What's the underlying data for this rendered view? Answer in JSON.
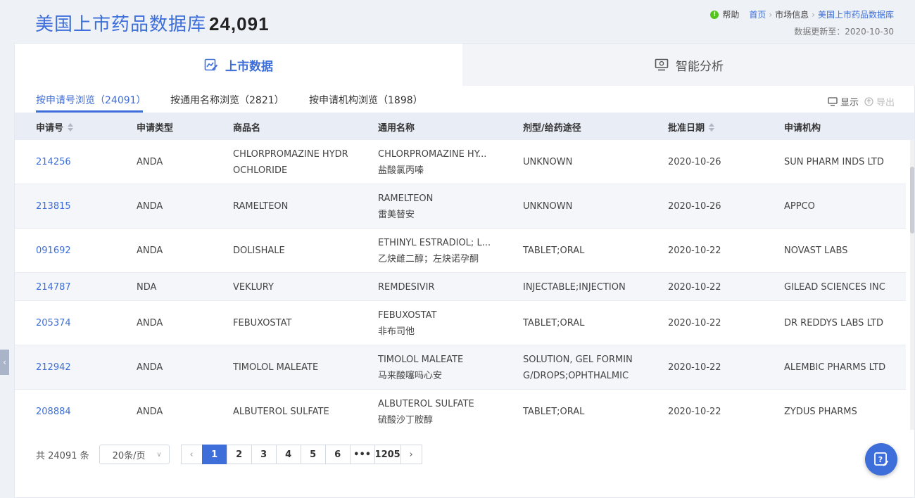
{
  "header": {
    "title": "美国上市药品数据库",
    "count": "24,091",
    "help_label": "帮助",
    "breadcrumb": [
      "首页",
      "市场信息",
      "美国上市药品数据库"
    ],
    "update_label": "数据更新至：",
    "update_date": "2020-10-30"
  },
  "tabs": [
    {
      "label": "上市数据",
      "active": true
    },
    {
      "label": "智能分析",
      "active": false
    }
  ],
  "subnav": [
    {
      "label": "按申请号浏览（24091）",
      "active": true
    },
    {
      "label": "按通用名称浏览（2821）",
      "active": false
    },
    {
      "label": "按申请机构浏览（1898）",
      "active": false
    }
  ],
  "toolbar": {
    "display_label": "显示",
    "export_label": "导出"
  },
  "columns": [
    "申请号",
    "申请类型",
    "商品名",
    "通用名称",
    "剂型/给药途径",
    "批准日期",
    "申请机构"
  ],
  "rows": [
    {
      "appl_no": "214256",
      "type": "ANDA",
      "trade_name": [
        "CHLORPROMAZINE HYDR",
        "OCHLORIDE"
      ],
      "generic_en": "CHLORPROMAZINE HY...",
      "generic_cn": "盐酸氯丙嗪",
      "dosage": [
        "UNKNOWN"
      ],
      "date": "2020-10-26",
      "applicant": "SUN PHARM INDS LTD"
    },
    {
      "appl_no": "213815",
      "type": "ANDA",
      "trade_name": [
        "RAMELTEON"
      ],
      "generic_en": "RAMELTEON",
      "generic_cn": "雷美替安",
      "dosage": [
        "UNKNOWN"
      ],
      "date": "2020-10-26",
      "applicant": "APPCO"
    },
    {
      "appl_no": "091692",
      "type": "ANDA",
      "trade_name": [
        "DOLISHALE"
      ],
      "generic_en": "ETHINYL ESTRADIOL; L...",
      "generic_cn": "乙炔雌二醇；左炔诺孕酮",
      "dosage": [
        "TABLET;ORAL"
      ],
      "date": "2020-10-22",
      "applicant": "NOVAST LABS"
    },
    {
      "appl_no": "214787",
      "type": "NDA",
      "trade_name": [
        "VEKLURY"
      ],
      "generic_en": "REMDESIVIR",
      "generic_cn": "",
      "dosage": [
        "INJECTABLE;INJECTION"
      ],
      "date": "2020-10-22",
      "applicant": "GILEAD SCIENCES INC"
    },
    {
      "appl_no": "205374",
      "type": "ANDA",
      "trade_name": [
        "FEBUXOSTAT"
      ],
      "generic_en": "FEBUXOSTAT",
      "generic_cn": "非布司他",
      "dosage": [
        "TABLET;ORAL"
      ],
      "date": "2020-10-22",
      "applicant": "DR REDDYS LABS LTD"
    },
    {
      "appl_no": "212942",
      "type": "ANDA",
      "trade_name": [
        "TIMOLOL MALEATE"
      ],
      "generic_en": "TIMOLOL MALEATE",
      "generic_cn": "马来酸噻吗心安",
      "dosage": [
        "SOLUTION, GEL FORMIN",
        "G/DROPS;OPHTHALMIC"
      ],
      "date": "2020-10-22",
      "applicant": "ALEMBIC PHARMS LTD"
    },
    {
      "appl_no": "208884",
      "type": "ANDA",
      "trade_name": [
        "ALBUTEROL SULFATE"
      ],
      "generic_en": "ALBUTEROL SULFATE",
      "generic_cn": "硫酸沙丁胺醇",
      "dosage": [
        "TABLET;ORAL"
      ],
      "date": "2020-10-22",
      "applicant": "ZYDUS PHARMS"
    }
  ],
  "pagination": {
    "total_label": "共 24091 条",
    "page_size": "20条/页",
    "pages": [
      "1",
      "2",
      "3",
      "4",
      "5",
      "6",
      "•••",
      "1205"
    ],
    "current": "1"
  },
  "colors": {
    "primary": "#3d6ed9",
    "help_green": "#52c41a"
  }
}
